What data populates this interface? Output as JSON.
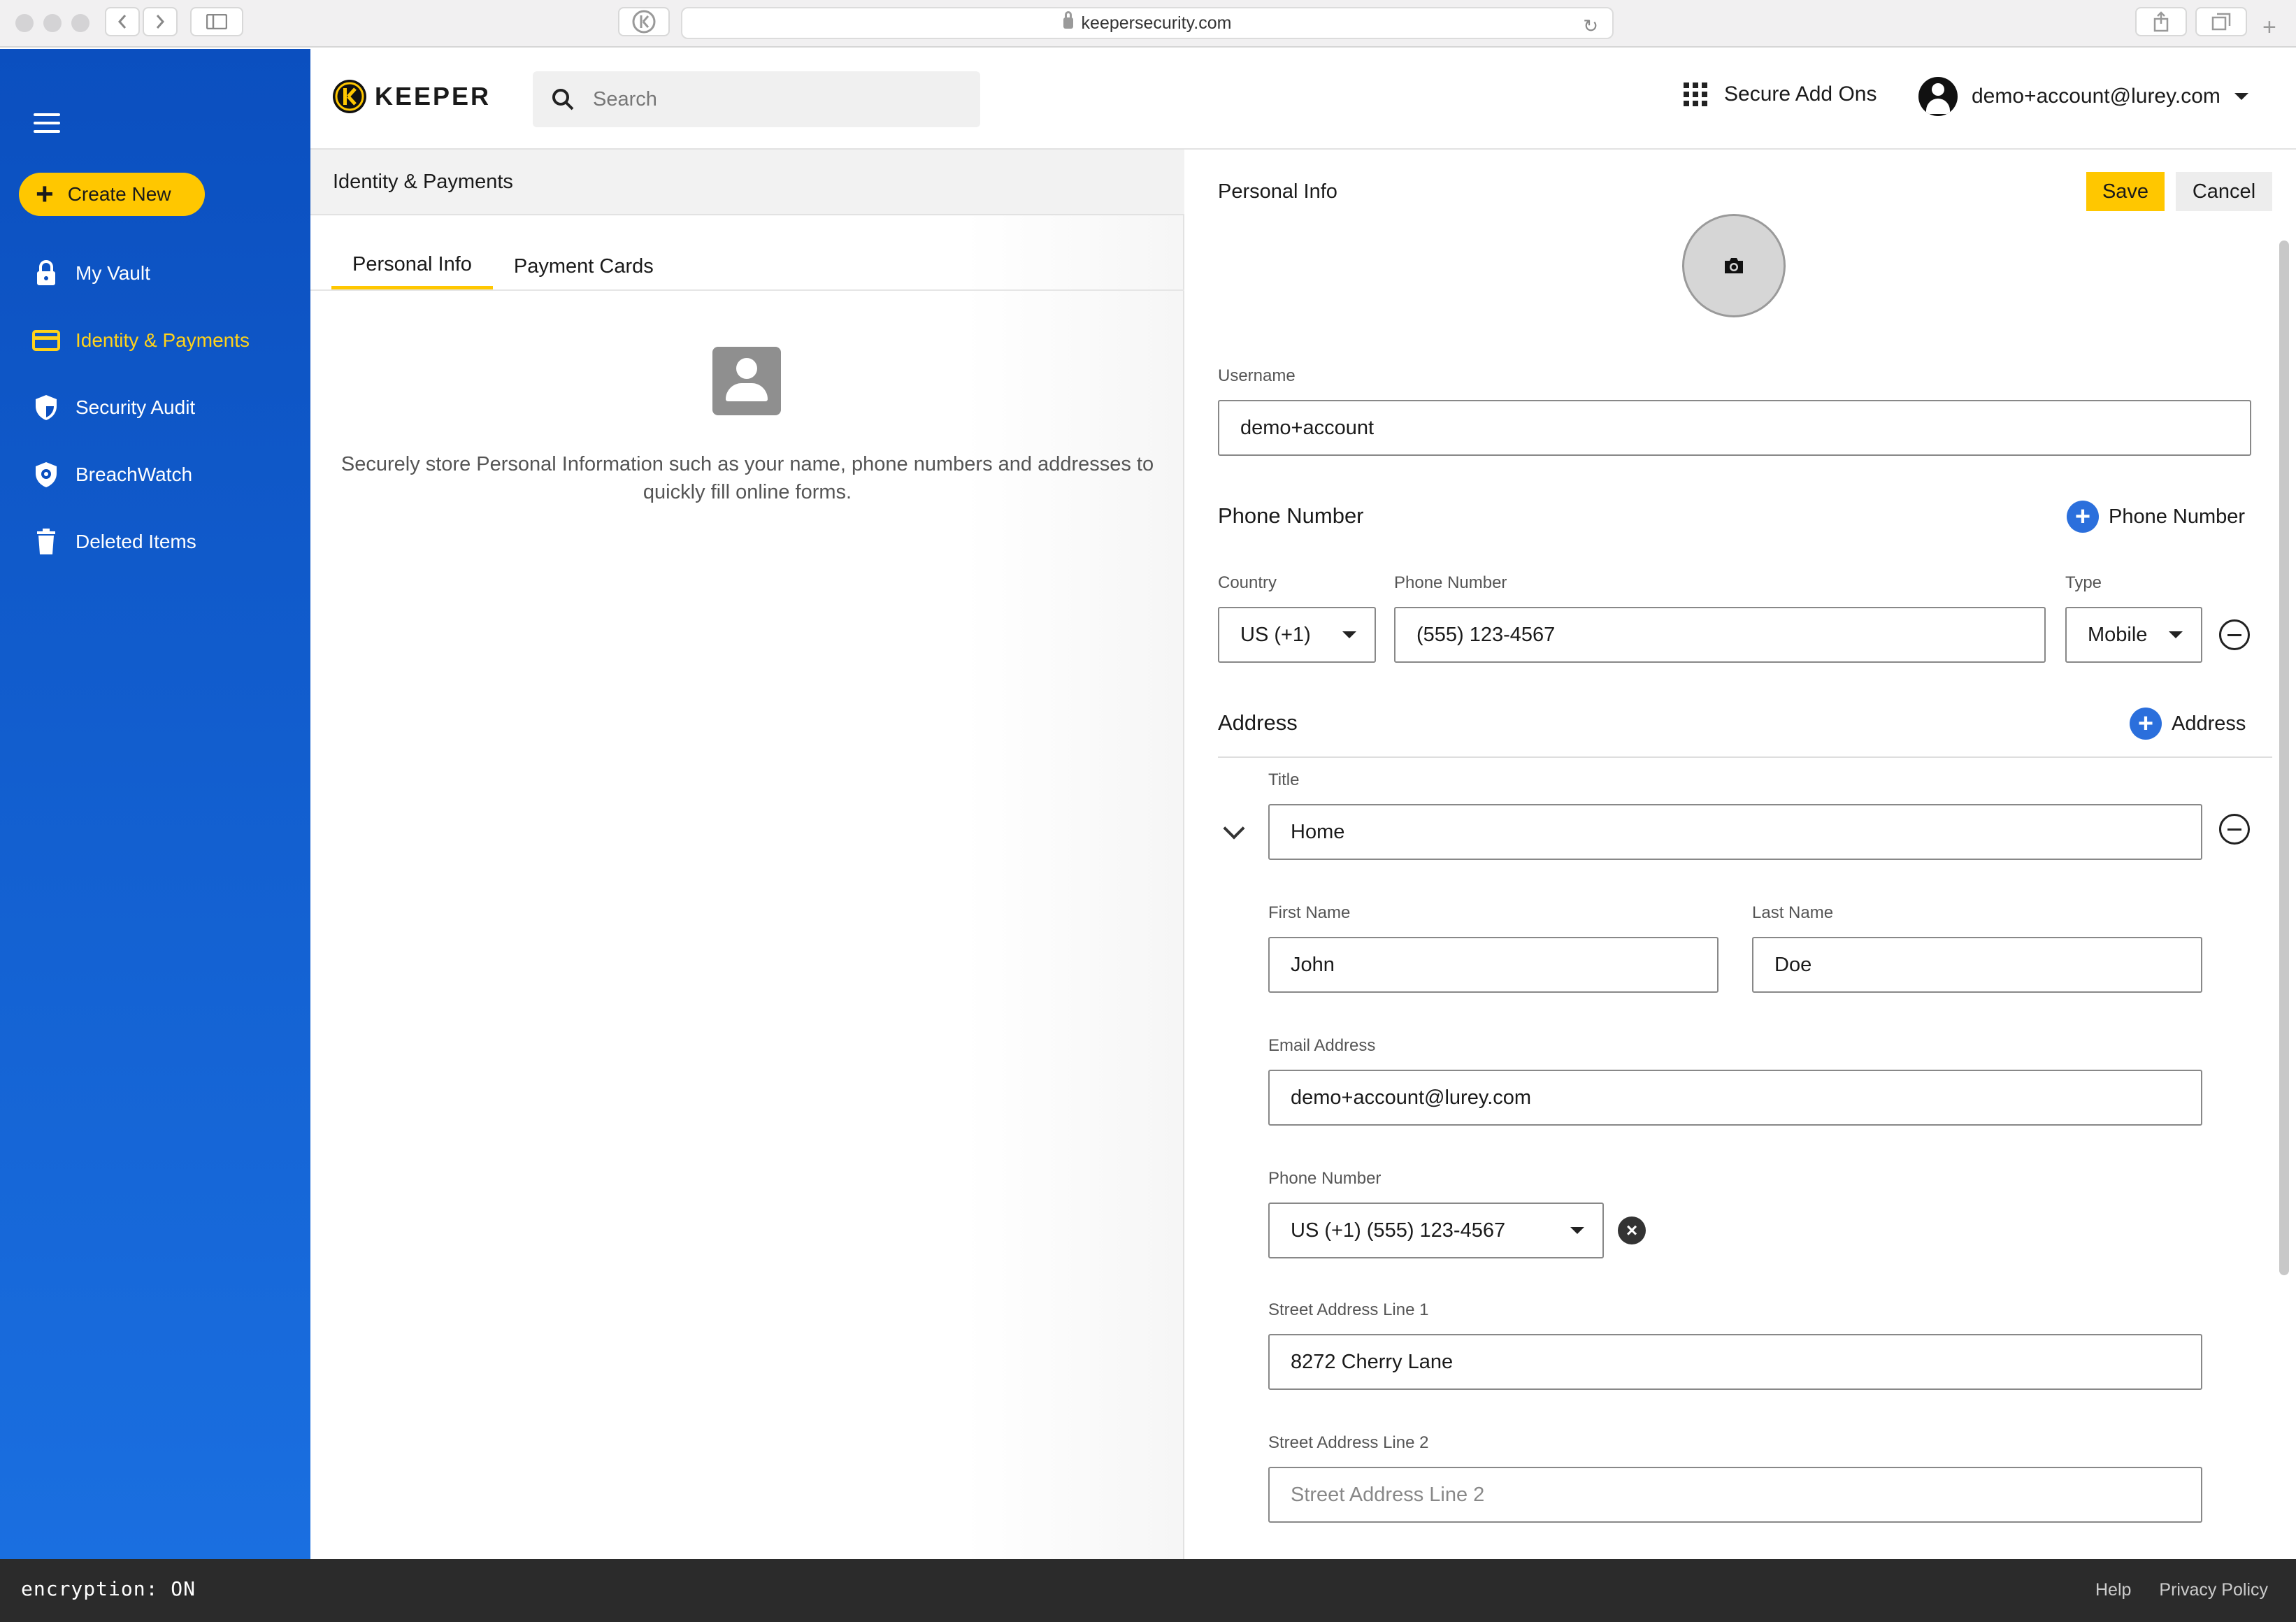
{
  "browser": {
    "url": "keepersecurity.com"
  },
  "sidebar": {
    "create_new_label": "Create New",
    "items": [
      {
        "label": "My Vault",
        "icon": "lock-icon"
      },
      {
        "label": "Identity & Payments",
        "icon": "card-icon",
        "active": true
      },
      {
        "label": "Security Audit",
        "icon": "shield-icon"
      },
      {
        "label": "BreachWatch",
        "icon": "breachwatch-icon"
      },
      {
        "label": "Deleted Items",
        "icon": "trash-icon"
      }
    ],
    "colors": {
      "background": "#0b4fbf",
      "active": "#ffd21a",
      "accent": "#ffc700"
    }
  },
  "header": {
    "logo_text": "KEEPER",
    "search_placeholder": "Search",
    "addons_label": "Secure Add Ons",
    "account_email": "demo+account@lurey.com"
  },
  "list_pane": {
    "title": "Identity & Payments",
    "tabs": [
      {
        "label": "Personal Info",
        "active": true
      },
      {
        "label": "Payment Cards",
        "active": false
      }
    ],
    "empty_message": "Securely store Personal Information such as your name, phone numbers and addresses to quickly fill online forms."
  },
  "detail": {
    "title": "Personal Info",
    "save_label": "Save",
    "cancel_label": "Cancel",
    "username": {
      "label": "Username",
      "value": "demo+account"
    },
    "phone_section": {
      "heading": "Phone Number",
      "add_label": "Phone Number",
      "country_label": "Country",
      "country_value": "US (+1)",
      "number_label": "Phone Number",
      "number_value": "(555) 123-4567",
      "type_label": "Type",
      "type_value": "Mobile"
    },
    "address_section": {
      "heading": "Address",
      "add_label": "Address",
      "title_label": "Title",
      "title_value": "Home",
      "first_name_label": "First Name",
      "first_name_value": "John",
      "last_name_label": "Last Name",
      "last_name_value": "Doe",
      "email_label": "Email Address",
      "email_value": "demo+account@lurey.com",
      "phone_label": "Phone Number",
      "phone_value": "US (+1) (555) 123-4567",
      "street1_label": "Street Address Line 1",
      "street1_value": "8272 Cherry Lane",
      "street2_label": "Street Address Line 2",
      "street2_placeholder": "Street Address Line 2"
    }
  },
  "footer": {
    "encryption": "encryption: ON",
    "help": "Help",
    "privacy": "Privacy Policy"
  }
}
